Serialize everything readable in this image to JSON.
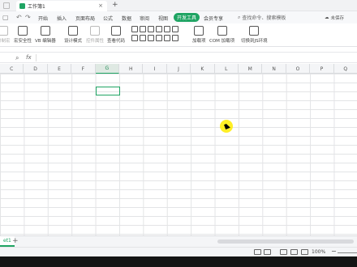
{
  "titlebar": {
    "doc_title": "工作簿1",
    "close": "×",
    "add": "+"
  },
  "menu": {
    "items": [
      "开始",
      "插入",
      "页面布局",
      "公式",
      "数据",
      "审阅",
      "视图",
      "开发工具",
      "会员专享"
    ],
    "active": "开发工具",
    "search_placeholder": "查找命令、搜索模板",
    "unsaved": "未保存"
  },
  "ribbon": {
    "buttons": [
      "宏安全性",
      "VB 编辑器",
      "设计模式",
      "控件属性",
      "查看代码",
      "加载项",
      "COM 加载项",
      "切换到JS环境"
    ],
    "partial_left": "录制宏"
  },
  "formula": {
    "fx": "fx"
  },
  "columns": [
    "C",
    "D",
    "E",
    "F",
    "G",
    "H",
    "I",
    "J",
    "K",
    "L",
    "M",
    "N",
    "O",
    "P",
    "Q"
  ],
  "selected_column": "G",
  "sheet": {
    "tab": "et1",
    "add": "+"
  },
  "status": {
    "zoom": "100%",
    "zoom_minus": "−"
  },
  "colors": {
    "accent": "#1fa463"
  }
}
